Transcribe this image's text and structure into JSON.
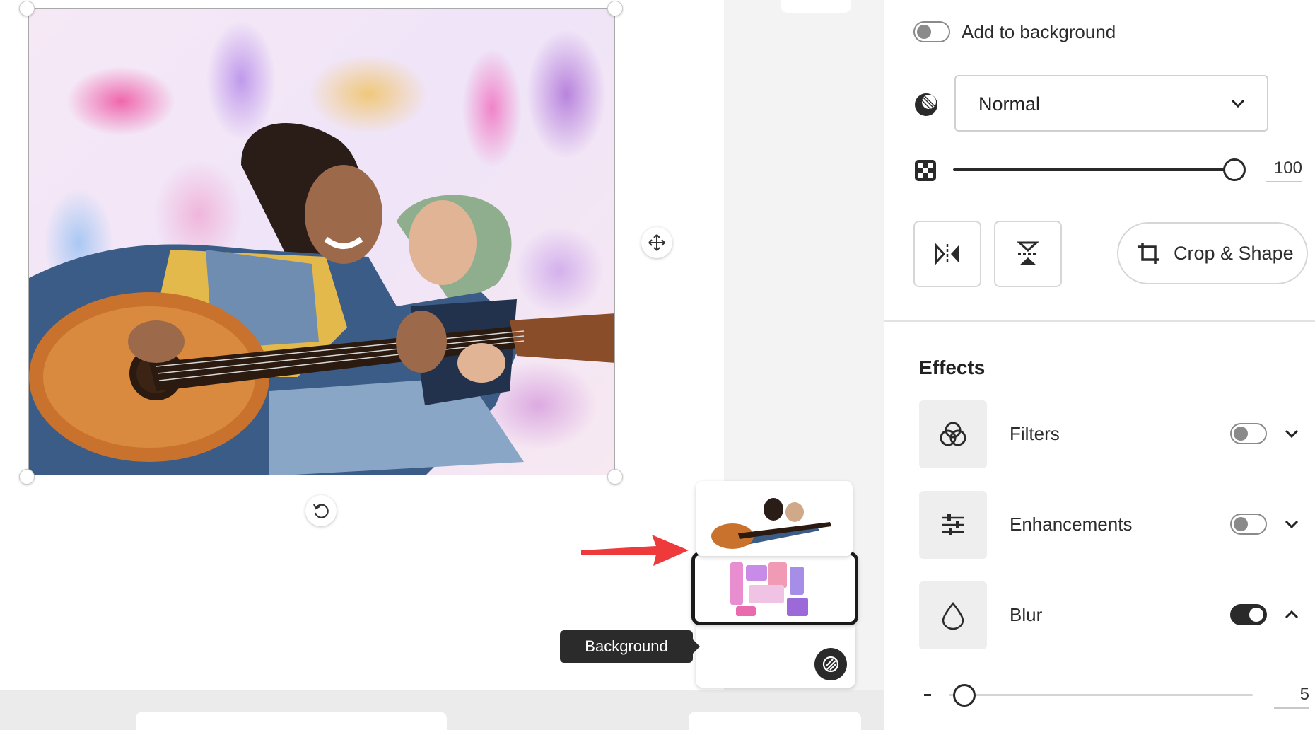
{
  "panel": {
    "add_to_background_label": "Add to background",
    "blend_mode": "Normal",
    "opacity_value": "100",
    "crop_shape_label": "Crop & Shape",
    "effects_title": "Effects",
    "effects": [
      {
        "label": "Filters",
        "enabled": false
      },
      {
        "label": "Enhancements",
        "enabled": false
      },
      {
        "label": "Blur",
        "enabled": true
      }
    ],
    "blur_value": "5"
  },
  "layers": {
    "tooltip": "Background"
  },
  "levels": {
    "opacity_fraction": 1.0,
    "blur_fraction": 0.05
  },
  "colors": {
    "annotation_arrow": "#ee3a3a",
    "toggle_on": "#2a2a2a",
    "toggle_off": "#8a8a8a"
  },
  "icons": [
    "rotate-icon",
    "move-icon",
    "blend-mode-icon",
    "opacity-icon",
    "flip-horizontal-icon",
    "flip-vertical-icon",
    "crop-icon",
    "filters-icon",
    "enhancements-icon",
    "blur-drop-icon",
    "chevron-down-icon",
    "chevron-up-icon",
    "background-layer-icon"
  ]
}
